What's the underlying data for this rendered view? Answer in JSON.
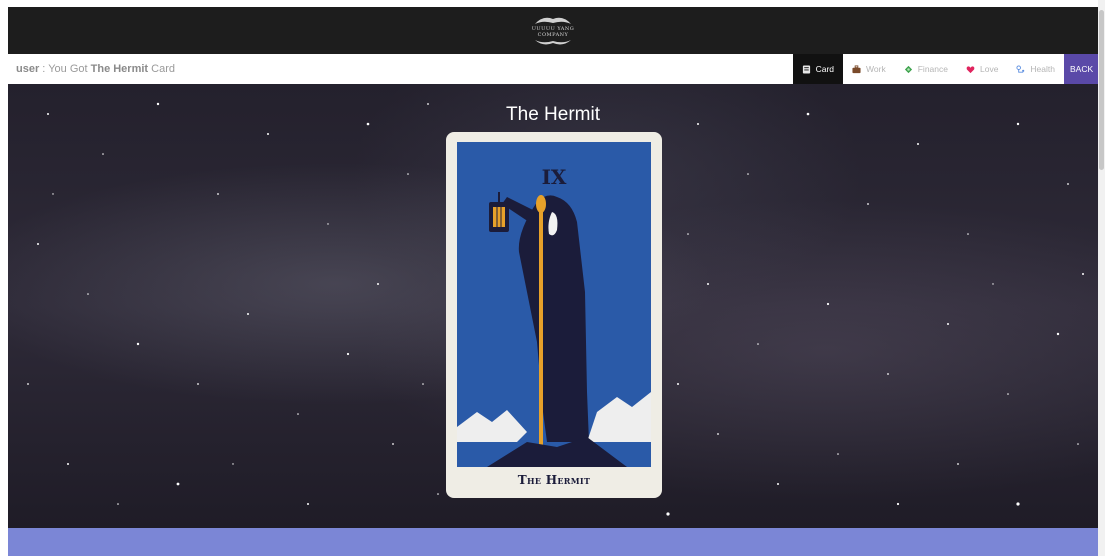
{
  "header": {
    "logo_text_line1": "UUUUU YANG",
    "logo_text_line2": "COMPANY"
  },
  "nav": {
    "user_name": "user",
    "user_separator": " : You Got ",
    "card_name": "The Hermit",
    "user_suffix": " Card",
    "tabs": [
      {
        "label": "Card",
        "icon": "card-icon",
        "color": "#e8e8e8",
        "active": true
      },
      {
        "label": "Work",
        "icon": "briefcase-icon",
        "color": "#7a4a2a",
        "active": false
      },
      {
        "label": "Finance",
        "icon": "money-icon",
        "color": "#3ca24c",
        "active": false
      },
      {
        "label": "Love",
        "icon": "heart-icon",
        "color": "#e0245e",
        "active": false
      },
      {
        "label": "Health",
        "icon": "health-icon",
        "color": "#5b8ee0",
        "active": false
      }
    ],
    "back_label": "BACK"
  },
  "main": {
    "title": "The Hermit",
    "card_numeral": "IX",
    "card_caption": "The Hermit"
  },
  "colors": {
    "header_bg": "#1d1d1d",
    "active_tab_bg": "#111111",
    "back_bg": "#5a49a8",
    "bottom_band": "#7b86d6",
    "card_blue": "#2a5aa8",
    "card_navy": "#1b1c3a",
    "lantern_gold": "#e7a12a"
  }
}
